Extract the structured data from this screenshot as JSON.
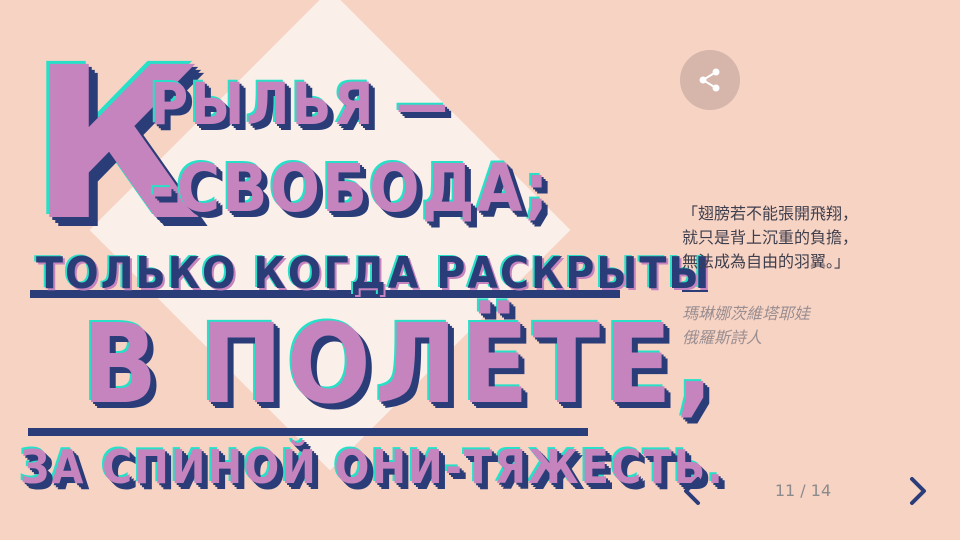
{
  "artwork": {
    "letter_k": "К",
    "line1": "РЫЛЬЯ —",
    "line2": "-СВОБОДА;",
    "line3": "ТОЛЬКО КОГДА РАСКРЫТЫ",
    "line4": "В ПОЛЁТЕ,",
    "line5": "ЗА СПИНОЙ ОНИ-ТЯЖЕСТЬ.",
    "colors": {
      "pink": "#c584bd",
      "navy": "#2b3d78",
      "teal": "#28e0c8",
      "cream": "#fbefe9"
    }
  },
  "share": {
    "icon": "share-icon"
  },
  "quote": {
    "text": "「翅膀若不能張開飛翔，\n就只是背上沉重的負擔，\n無法成為自由的羽翼。」",
    "author": "瑪琳娜茨維塔耶娃\n俄羅斯詩人"
  },
  "pagination": {
    "prev_icon": "chevron-left-icon",
    "next_icon": "chevron-right-icon",
    "counter": "11 / 14"
  },
  "colors": {
    "background": "#f7d3c4",
    "accent": "#2b3d78"
  }
}
